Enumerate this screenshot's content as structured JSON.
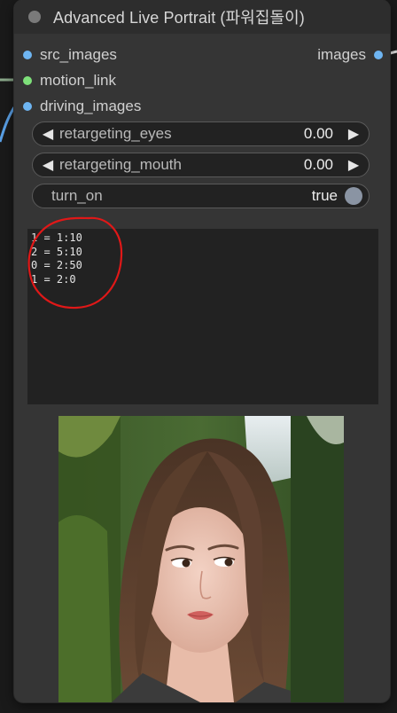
{
  "node": {
    "title": "Advanced Live Portrait (파워집돌이)",
    "inputs": [
      {
        "label": "src_images",
        "color": "#6eb5f2"
      },
      {
        "label": "motion_link",
        "color": "#7ee07a"
      },
      {
        "label": "driving_images",
        "color": "#6eb5f2"
      }
    ],
    "output": {
      "label": "images",
      "color": "#6eb5f2"
    },
    "widgets": {
      "retargeting_eyes": {
        "label": "retargeting_eyes",
        "value": "0.00"
      },
      "retargeting_mouth": {
        "label": "retargeting_mouth",
        "value": "0.00"
      },
      "turn_on": {
        "label": "turn_on",
        "value": "true"
      }
    },
    "command_text": [
      "1 = 1:10",
      "2 = 5:10",
      "0 = 2:50",
      "1 = 2:0"
    ]
  },
  "colors": {
    "node_body": "#353535",
    "title_bar": "#2d2d2d",
    "annotation": "#e01818"
  }
}
